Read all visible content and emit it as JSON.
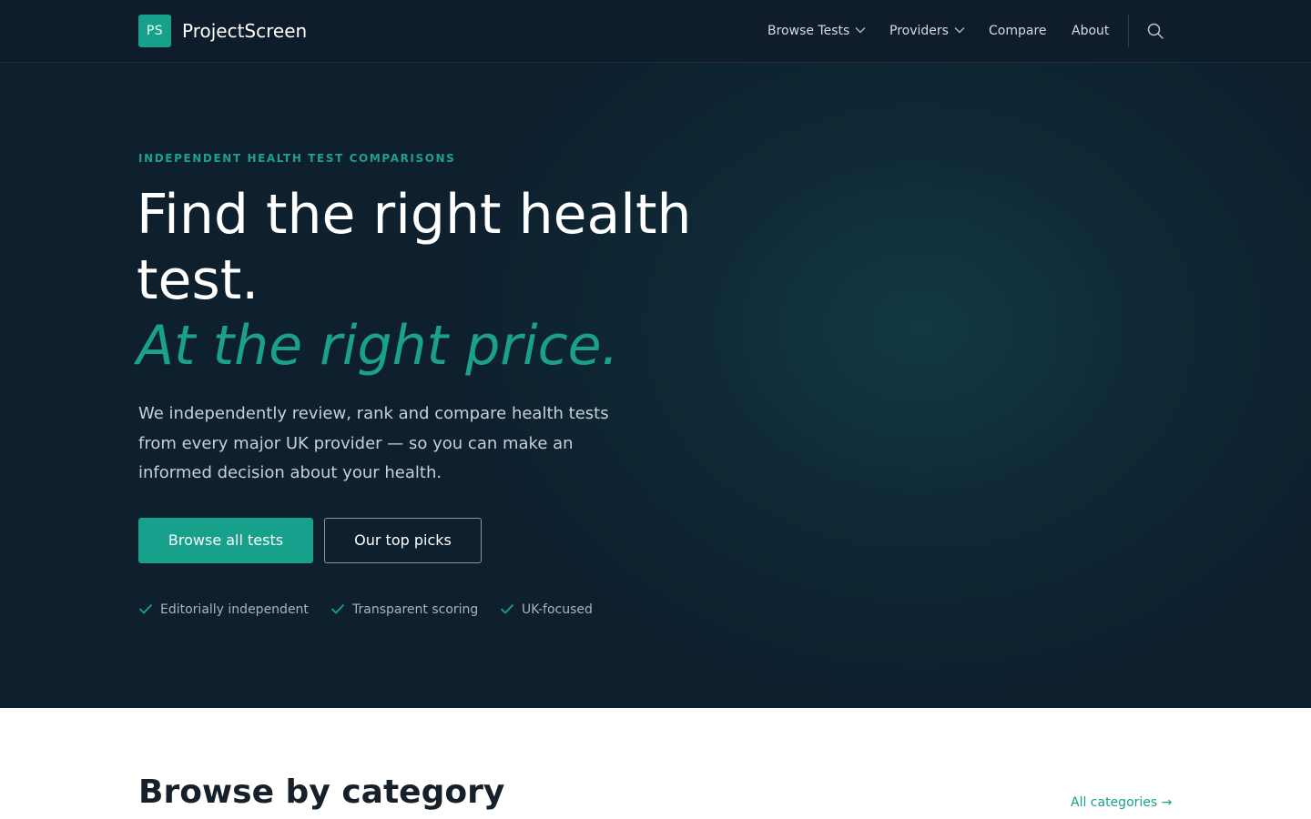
{
  "brand": {
    "badge": "PS",
    "name": "ProjectScreen"
  },
  "nav": {
    "items": [
      {
        "label": "Browse Tests",
        "has_dropdown": true
      },
      {
        "label": "Providers",
        "has_dropdown": true
      },
      {
        "label": "Compare",
        "has_dropdown": false
      },
      {
        "label": "About",
        "has_dropdown": false
      }
    ],
    "search_icon": "search-icon",
    "dropdown_icon": "chevron-down-icon"
  },
  "hero": {
    "eyebrow": "INDEPENDENT HEALTH TEST COMPARISONS",
    "headline": "Find the right health test.",
    "headline_accent": "At the right price.",
    "lede": "We independently review, rank and compare health tests from every major UK provider — so you can make an informed decision about your health.",
    "primary_cta": "Browse all tests",
    "secondary_cta": "Our top picks",
    "trust_points": [
      "Editorially independent",
      "Transparent scoring",
      "UK-focused"
    ],
    "trust_icon": "check-icon"
  },
  "categories": {
    "title": "Browse by category",
    "all_link": "All categories →"
  },
  "colors": {
    "accent": "#17a08c",
    "hero_background": "#0f1f2e",
    "nav_background": "#0f1c2b",
    "heading_dark": "#16202b"
  }
}
